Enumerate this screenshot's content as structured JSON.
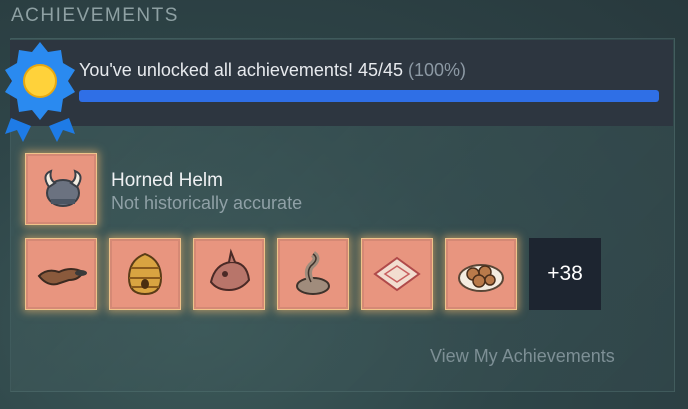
{
  "section": {
    "title": "ACHIEVEMENTS"
  },
  "banner": {
    "message": "You've unlocked all achievements! 45/45",
    "percent_text": "(100%)",
    "progress": 1.0,
    "colors": {
      "fill": "#2f6fe6",
      "badge": "#2a8af0",
      "sun": "#ffd23a"
    }
  },
  "featured": {
    "name": "Horned Helm",
    "description": "Not historically accurate",
    "icon": "horned-helm-icon"
  },
  "recent": [
    {
      "icon": "platypus-icon"
    },
    {
      "icon": "beehive-icon"
    },
    {
      "icon": "dinosaur-skull-icon"
    },
    {
      "icon": "snake-icon"
    },
    {
      "icon": "carpet-icon"
    },
    {
      "icon": "dumplings-plate-icon"
    }
  ],
  "more_count": "+38",
  "link": {
    "label": "View My Achievements"
  }
}
